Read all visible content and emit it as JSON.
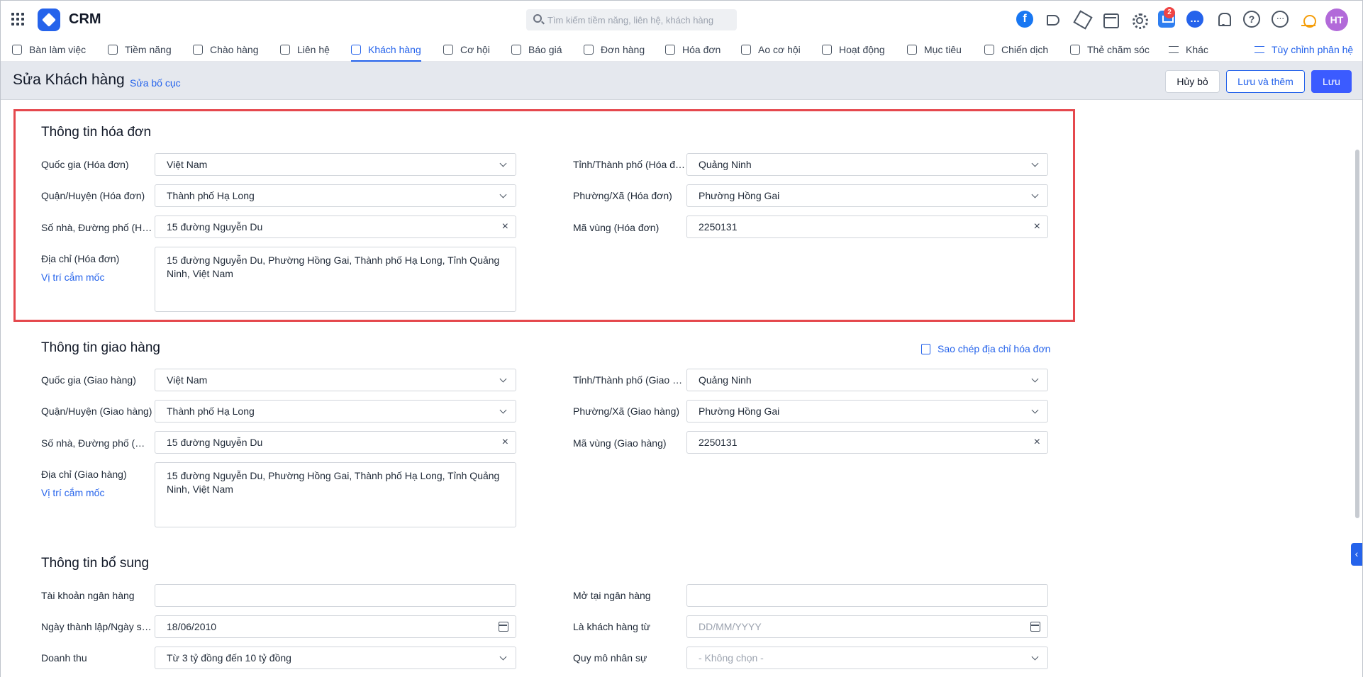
{
  "app": {
    "name": "CRM"
  },
  "search": {
    "placeholder": "Tìm kiếm tiềm năng, liên hệ, khách hàng"
  },
  "notifications": {
    "cart_badge": "2"
  },
  "user": {
    "initials": "HT"
  },
  "colors": {
    "accent": "#2563eb",
    "highlight_border": "#e5484d",
    "primary_button": "#3b5bff",
    "badge": "#ef4444"
  },
  "nav": {
    "items": [
      {
        "label": "Bàn làm việc",
        "icon": "home-icon"
      },
      {
        "label": "Tiềm năng",
        "icon": "user-icon"
      },
      {
        "label": "Chào hàng",
        "icon": "magnet-icon"
      },
      {
        "label": "Liên hệ",
        "icon": "contact-icon"
      },
      {
        "label": "Khách hàng",
        "icon": "building-icon"
      },
      {
        "label": "Cơ hội",
        "icon": "wallet-icon"
      },
      {
        "label": "Báo giá",
        "icon": "document-icon"
      },
      {
        "label": "Đơn hàng",
        "icon": "cart-icon"
      },
      {
        "label": "Hóa đơn",
        "icon": "invoice-icon"
      },
      {
        "label": "Ao cơ hội",
        "icon": "funnel-icon"
      },
      {
        "label": "Hoạt động",
        "icon": "activity-icon"
      },
      {
        "label": "Mục tiêu",
        "icon": "target-icon"
      },
      {
        "label": "Chiến dịch",
        "icon": "megaphone-icon"
      },
      {
        "label": "Thẻ chăm sóc",
        "icon": "care-icon"
      },
      {
        "label": "Khác",
        "icon": "menu-icon"
      }
    ],
    "active": "Khách hàng",
    "customize_label": "Tùy chỉnh phân hệ"
  },
  "header": {
    "title": "Sửa Khách hàng",
    "edit_layout_label": "Sửa bố cục",
    "cancel_label": "Hủy bỏ",
    "save_add_label": "Lưu và thêm",
    "save_label": "Lưu"
  },
  "billing": {
    "title": "Thông tin hóa đơn",
    "country_label": "Quốc gia (Hóa đơn)",
    "country_value": "Việt Nam",
    "province_label": "Tỉnh/Thành phố (Hóa đơn)",
    "province_value": "Quảng Ninh",
    "district_label": "Quận/Huyện (Hóa đơn)",
    "district_value": "Thành phố Hạ Long",
    "ward_label": "Phường/Xã (Hóa đơn)",
    "ward_value": "Phường Hồng Gai",
    "street_label": "Số nhà, Đường phố (Hóa đơn)",
    "street_value": "15 đường Nguyễn Du",
    "zip_label": "Mã vùng (Hóa đơn)",
    "zip_value": "2250131",
    "address_label": "Địa chỉ (Hóa đơn)",
    "address_value": "15 đường Nguyễn Du, Phường Hồng Gai, Thành phố Hạ Long, Tỉnh Quảng Ninh, Việt Nam",
    "landmark_label": "Vị trí cắm mốc"
  },
  "shipping": {
    "title": "Thông tin giao hàng",
    "copy_label": "Sao chép địa chỉ hóa đơn",
    "country_label": "Quốc gia (Giao hàng)",
    "country_value": "Việt Nam",
    "province_label": "Tỉnh/Thành phố (Giao hàng)",
    "province_value": "Quảng Ninh",
    "district_label": "Quận/Huyện (Giao hàng)",
    "district_value": "Thành phố Hạ Long",
    "ward_label": "Phường/Xã (Giao hàng)",
    "ward_value": "Phường Hồng Gai",
    "street_label": "Số nhà, Đường phố (Giao hàng)",
    "street_value": "15 đường Nguyễn Du",
    "zip_label": "Mã vùng (Giao hàng)",
    "zip_value": "2250131",
    "address_label": "Địa chỉ (Giao hàng)",
    "address_value": "15 đường Nguyễn Du, Phường Hồng Gai, Thành phố Hạ Long, Tỉnh Quảng Ninh, Việt Nam",
    "landmark_label": "Vị trí cắm mốc"
  },
  "extra": {
    "title": "Thông tin bổ sung",
    "bank_account_label": "Tài khoản ngân hàng",
    "bank_account_value": "",
    "bank_name_label": "Mở tại ngân hàng",
    "bank_name_value": "",
    "founded_label": "Ngày thành lập/Ngày sinh",
    "founded_value": "18/06/2010",
    "customer_since_label": "Là khách hàng từ",
    "customer_since_placeholder": "DD/MM/YYYY",
    "revenue_label": "Doanh thu",
    "revenue_value": "Từ 3 tỷ đồng đến 10 tỷ đồng",
    "staff_size_label": "Quy mô nhân sự",
    "staff_size_value": "- Không chọn -"
  }
}
